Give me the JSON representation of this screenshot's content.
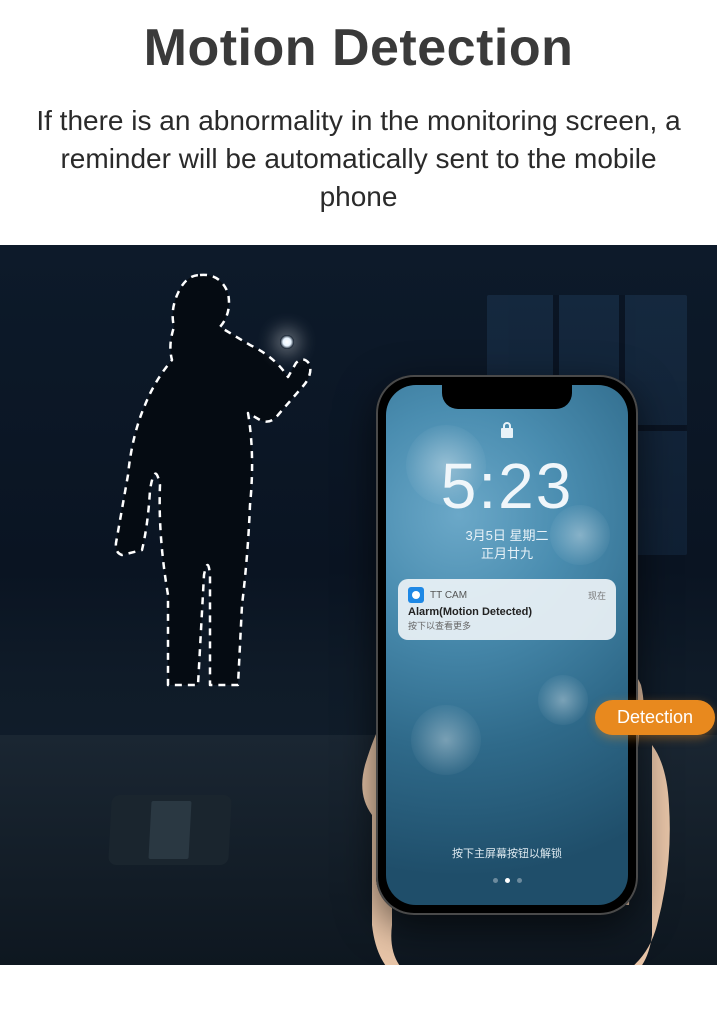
{
  "title": "Motion Detection",
  "subtitle": "If there is an abnormality in the monitoring screen, a reminder will be automatically sent to the mobile phone",
  "badge": "Detection",
  "phone": {
    "time": "5:23",
    "date_line1": "3月5日 星期二",
    "date_line2": "正月廿九",
    "swipe_hint": "按下主屏幕按钮以解锁"
  },
  "notification": {
    "app_name": "TT CAM",
    "time_label": "现在",
    "title": "Alarm(Motion Detected)",
    "subtitle": "按下以查看更多"
  },
  "colors": {
    "badge_bg": "#e8891e",
    "scene_bg": "#0d1a2a",
    "screen_accent": "#4a8db0"
  }
}
